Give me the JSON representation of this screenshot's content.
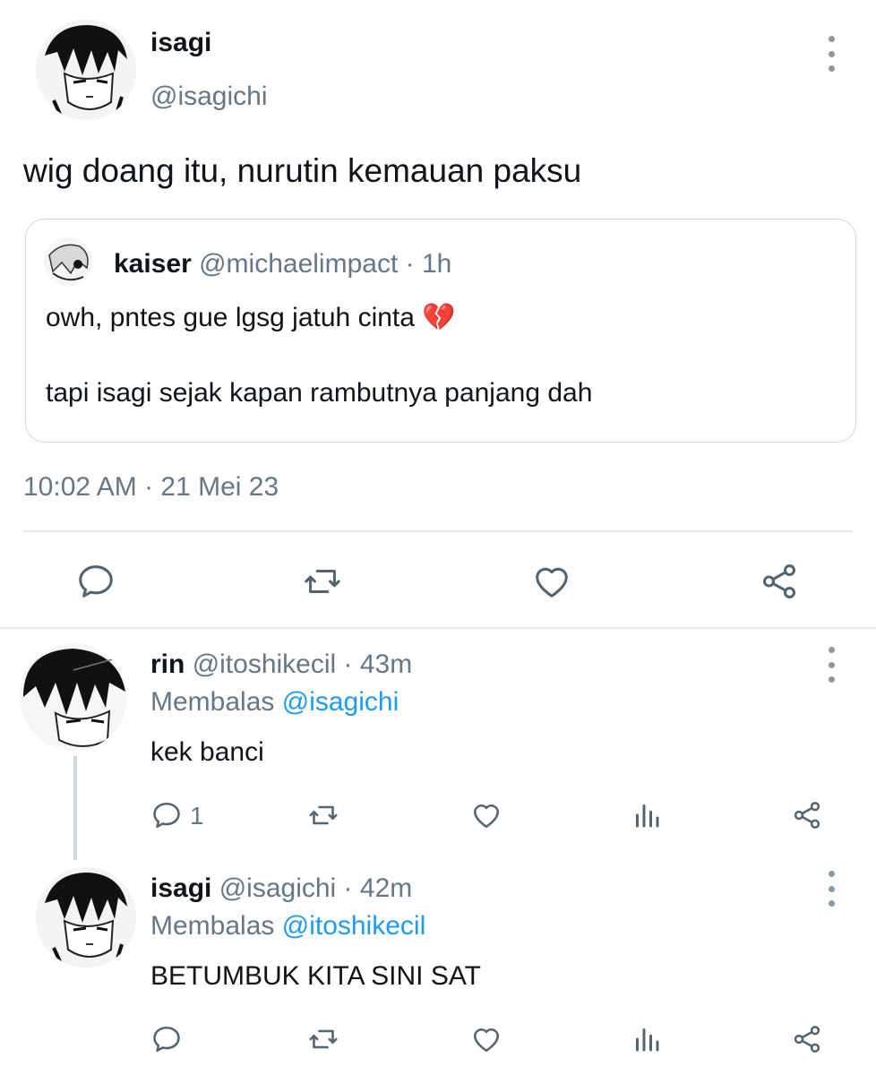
{
  "main_tweet": {
    "display_name": "isagi",
    "handle": "@isagichi",
    "text": "wig doang itu, nurutin kemauan paksu",
    "quote": {
      "display_name": "kaiser",
      "handle_time": "@michaelimpact · 1h",
      "line1": "owh, pntes gue lgsg jatuh cinta",
      "emoji": "💔",
      "line2": "tapi isagi sejak kapan rambutnya panjang dah"
    },
    "timestamp": "10:02 AM · 21 Mei 23"
  },
  "replies": [
    {
      "display_name": "rin",
      "handle_time": "@itoshikecil · 43m",
      "replying_label": "Membalas",
      "replying_to": "@isagichi",
      "text": "kek banci",
      "reply_count": "1"
    },
    {
      "display_name": "isagi",
      "handle_time": "@isagichi · 42m",
      "replying_label": "Membalas",
      "replying_to": "@itoshikecil",
      "text": "BETUMBUK KITA SINI SAT",
      "reply_count": ""
    }
  ],
  "icons": {
    "reply": "reply-icon",
    "retweet": "retweet-icon",
    "like": "heart-icon",
    "views": "views-icon",
    "share": "share-icon",
    "more": "more-options-icon"
  },
  "colors": {
    "link": "#1d9bf0",
    "muted": "#657786",
    "icon": "#536471"
  }
}
